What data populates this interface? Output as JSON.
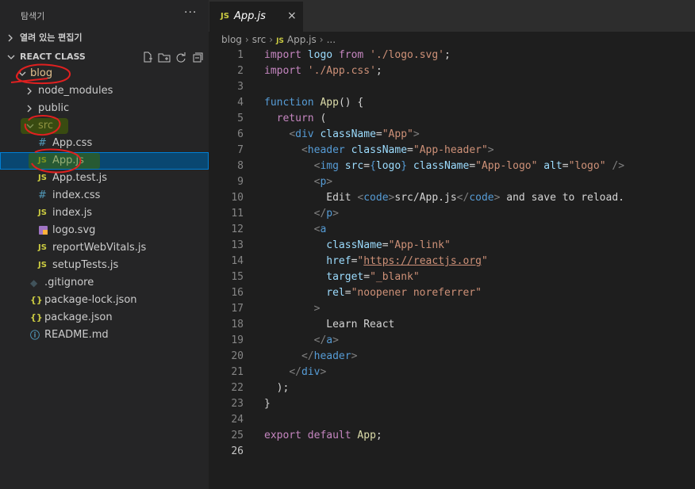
{
  "explorer": {
    "title": "탐색기",
    "more": "···",
    "open_editors": "열려 있는 편집기",
    "workspace": "REACT CLASS"
  },
  "tree": [
    {
      "name": "blog",
      "kind": "folder",
      "open": true,
      "depth": 0
    },
    {
      "name": "node_modules",
      "kind": "folder",
      "open": false,
      "depth": 1
    },
    {
      "name": "public",
      "kind": "folder",
      "open": false,
      "depth": 1
    },
    {
      "name": "src",
      "kind": "folder",
      "open": true,
      "depth": 1
    },
    {
      "name": "App.css",
      "kind": "css",
      "icon": "#",
      "depth": 2
    },
    {
      "name": "App.js",
      "kind": "js",
      "icon": "JS",
      "depth": 2,
      "selected": true
    },
    {
      "name": "App.test.js",
      "kind": "js",
      "icon": "JS",
      "depth": 2
    },
    {
      "name": "index.css",
      "kind": "css",
      "icon": "#",
      "depth": 2
    },
    {
      "name": "index.js",
      "kind": "js",
      "icon": "JS",
      "depth": 2
    },
    {
      "name": "logo.svg",
      "kind": "svg",
      "icon": "▪",
      "depth": 2
    },
    {
      "name": "reportWebVitals.js",
      "kind": "js",
      "icon": "JS",
      "depth": 2
    },
    {
      "name": "setupTests.js",
      "kind": "js",
      "icon": "JS",
      "depth": 2
    },
    {
      "name": ".gitignore",
      "kind": "git",
      "icon": "◆",
      "depth": 1
    },
    {
      "name": "package-lock.json",
      "kind": "json",
      "icon": "{}",
      "depth": 1
    },
    {
      "name": "package.json",
      "kind": "json",
      "icon": "{}",
      "depth": 1
    },
    {
      "name": "README.md",
      "kind": "info",
      "icon": "ⓘ",
      "depth": 1
    }
  ],
  "tab": {
    "label": "App.js",
    "badge": "JS",
    "close": "×"
  },
  "breadcrumb": {
    "parts": [
      "blog",
      "src",
      "App.js",
      "..."
    ],
    "badge": "JS"
  },
  "code": [
    [
      [
        "kw",
        "import"
      ],
      [
        "txt",
        " "
      ],
      [
        "var",
        "logo"
      ],
      [
        "txt",
        " "
      ],
      [
        "kw",
        "from"
      ],
      [
        "txt",
        " "
      ],
      [
        "str",
        "'./logo.svg'"
      ],
      [
        "txt",
        ";"
      ]
    ],
    [
      [
        "kw",
        "import"
      ],
      [
        "txt",
        " "
      ],
      [
        "str",
        "'./App.css'"
      ],
      [
        "txt",
        ";"
      ]
    ],
    [],
    [
      [
        "tag",
        "function"
      ],
      [
        "txt",
        " "
      ],
      [
        "fn",
        "App"
      ],
      [
        "txt",
        "() {"
      ]
    ],
    [
      [
        "txt",
        "  "
      ],
      [
        "kw",
        "return"
      ],
      [
        "txt",
        " ("
      ]
    ],
    [
      [
        "txt",
        "    "
      ],
      [
        "tg",
        "<"
      ],
      [
        "tag",
        "div"
      ],
      [
        "txt",
        " "
      ],
      [
        "attr",
        "className"
      ],
      [
        "txt",
        "="
      ],
      [
        "str",
        "\"App\""
      ],
      [
        "tg",
        ">"
      ]
    ],
    [
      [
        "txt",
        "      "
      ],
      [
        "tg",
        "<"
      ],
      [
        "tag",
        "header"
      ],
      [
        "txt",
        " "
      ],
      [
        "attr",
        "className"
      ],
      [
        "txt",
        "="
      ],
      [
        "str",
        "\"App-header\""
      ],
      [
        "tg",
        ">"
      ]
    ],
    [
      [
        "txt",
        "        "
      ],
      [
        "tg",
        "<"
      ],
      [
        "tag",
        "img"
      ],
      [
        "txt",
        " "
      ],
      [
        "attr",
        "src"
      ],
      [
        "txt",
        "="
      ],
      [
        "tag",
        "{"
      ],
      [
        "var",
        "logo"
      ],
      [
        "tag",
        "}"
      ],
      [
        "txt",
        " "
      ],
      [
        "attr",
        "className"
      ],
      [
        "txt",
        "="
      ],
      [
        "str",
        "\"App-logo\""
      ],
      [
        "txt",
        " "
      ],
      [
        "attr",
        "alt"
      ],
      [
        "txt",
        "="
      ],
      [
        "str",
        "\"logo\""
      ],
      [
        "txt",
        " "
      ],
      [
        "tg",
        "/>"
      ]
    ],
    [
      [
        "txt",
        "        "
      ],
      [
        "tg",
        "<"
      ],
      [
        "tag",
        "p"
      ],
      [
        "tg",
        ">"
      ]
    ],
    [
      [
        "txt",
        "          Edit "
      ],
      [
        "tg",
        "<"
      ],
      [
        "tag",
        "code"
      ],
      [
        "tg",
        ">"
      ],
      [
        "txt",
        "src/App.js"
      ],
      [
        "tg",
        "</"
      ],
      [
        "tag",
        "code"
      ],
      [
        "tg",
        ">"
      ],
      [
        "txt",
        " and save to reload."
      ]
    ],
    [
      [
        "txt",
        "        "
      ],
      [
        "tg",
        "</"
      ],
      [
        "tag",
        "p"
      ],
      [
        "tg",
        ">"
      ]
    ],
    [
      [
        "txt",
        "        "
      ],
      [
        "tg",
        "<"
      ],
      [
        "tag",
        "a"
      ]
    ],
    [
      [
        "txt",
        "          "
      ],
      [
        "attr",
        "className"
      ],
      [
        "txt",
        "="
      ],
      [
        "str",
        "\"App-link\""
      ]
    ],
    [
      [
        "txt",
        "          "
      ],
      [
        "attr",
        "href"
      ],
      [
        "txt",
        "="
      ],
      [
        "str",
        "\""
      ],
      [
        "strul",
        "https://reactjs.org"
      ],
      [
        "str",
        "\""
      ]
    ],
    [
      [
        "txt",
        "          "
      ],
      [
        "attr",
        "target"
      ],
      [
        "txt",
        "="
      ],
      [
        "str",
        "\"_blank\""
      ]
    ],
    [
      [
        "txt",
        "          "
      ],
      [
        "attr",
        "rel"
      ],
      [
        "txt",
        "="
      ],
      [
        "str",
        "\"noopener noreferrer\""
      ]
    ],
    [
      [
        "txt",
        "        "
      ],
      [
        "tg",
        ">"
      ]
    ],
    [
      [
        "txt",
        "          Learn React"
      ]
    ],
    [
      [
        "txt",
        "        "
      ],
      [
        "tg",
        "</"
      ],
      [
        "tag",
        "a"
      ],
      [
        "tg",
        ">"
      ]
    ],
    [
      [
        "txt",
        "      "
      ],
      [
        "tg",
        "</"
      ],
      [
        "tag",
        "header"
      ],
      [
        "tg",
        ">"
      ]
    ],
    [
      [
        "txt",
        "    "
      ],
      [
        "tg",
        "</"
      ],
      [
        "tag",
        "div"
      ],
      [
        "tg",
        ">"
      ]
    ],
    [
      [
        "txt",
        "  );"
      ]
    ],
    [
      [
        "txt",
        "}"
      ]
    ],
    [],
    [
      [
        "kw",
        "export"
      ],
      [
        "txt",
        " "
      ],
      [
        "kw",
        "default"
      ],
      [
        "txt",
        " "
      ],
      [
        "fn",
        "App"
      ],
      [
        "txt",
        ";"
      ]
    ],
    []
  ],
  "colors": {
    "selection": "#094771",
    "annotation_red": "#e02020",
    "highlight_green": "#4a6b00"
  }
}
